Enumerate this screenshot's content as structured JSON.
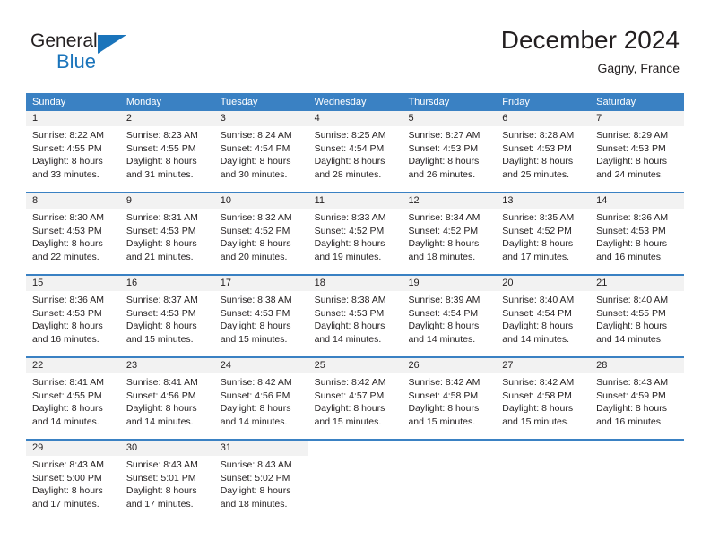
{
  "brand": {
    "name_part1": "General",
    "name_part2": "Blue",
    "accent_color": "#1a74bb",
    "triangle_icon": "triangle-icon"
  },
  "header": {
    "title": "December 2024",
    "subtitle": "Gagny, France"
  },
  "theme": {
    "header_blue": "#3a81c3",
    "daynum_gray": "#f2f2f2",
    "text": "#231f20"
  },
  "calendar": {
    "day_headers": [
      "Sunday",
      "Monday",
      "Tuesday",
      "Wednesday",
      "Thursday",
      "Friday",
      "Saturday"
    ],
    "weeks": [
      [
        {
          "day": "1",
          "sunrise": "Sunrise: 8:22 AM",
          "sunset": "Sunset: 4:55 PM",
          "daylight1": "Daylight: 8 hours",
          "daylight2": "and 33 minutes."
        },
        {
          "day": "2",
          "sunrise": "Sunrise: 8:23 AM",
          "sunset": "Sunset: 4:55 PM",
          "daylight1": "Daylight: 8 hours",
          "daylight2": "and 31 minutes."
        },
        {
          "day": "3",
          "sunrise": "Sunrise: 8:24 AM",
          "sunset": "Sunset: 4:54 PM",
          "daylight1": "Daylight: 8 hours",
          "daylight2": "and 30 minutes."
        },
        {
          "day": "4",
          "sunrise": "Sunrise: 8:25 AM",
          "sunset": "Sunset: 4:54 PM",
          "daylight1": "Daylight: 8 hours",
          "daylight2": "and 28 minutes."
        },
        {
          "day": "5",
          "sunrise": "Sunrise: 8:27 AM",
          "sunset": "Sunset: 4:53 PM",
          "daylight1": "Daylight: 8 hours",
          "daylight2": "and 26 minutes."
        },
        {
          "day": "6",
          "sunrise": "Sunrise: 8:28 AM",
          "sunset": "Sunset: 4:53 PM",
          "daylight1": "Daylight: 8 hours",
          "daylight2": "and 25 minutes."
        },
        {
          "day": "7",
          "sunrise": "Sunrise: 8:29 AM",
          "sunset": "Sunset: 4:53 PM",
          "daylight1": "Daylight: 8 hours",
          "daylight2": "and 24 minutes."
        }
      ],
      [
        {
          "day": "8",
          "sunrise": "Sunrise: 8:30 AM",
          "sunset": "Sunset: 4:53 PM",
          "daylight1": "Daylight: 8 hours",
          "daylight2": "and 22 minutes."
        },
        {
          "day": "9",
          "sunrise": "Sunrise: 8:31 AM",
          "sunset": "Sunset: 4:53 PM",
          "daylight1": "Daylight: 8 hours",
          "daylight2": "and 21 minutes."
        },
        {
          "day": "10",
          "sunrise": "Sunrise: 8:32 AM",
          "sunset": "Sunset: 4:52 PM",
          "daylight1": "Daylight: 8 hours",
          "daylight2": "and 20 minutes."
        },
        {
          "day": "11",
          "sunrise": "Sunrise: 8:33 AM",
          "sunset": "Sunset: 4:52 PM",
          "daylight1": "Daylight: 8 hours",
          "daylight2": "and 19 minutes."
        },
        {
          "day": "12",
          "sunrise": "Sunrise: 8:34 AM",
          "sunset": "Sunset: 4:52 PM",
          "daylight1": "Daylight: 8 hours",
          "daylight2": "and 18 minutes."
        },
        {
          "day": "13",
          "sunrise": "Sunrise: 8:35 AM",
          "sunset": "Sunset: 4:52 PM",
          "daylight1": "Daylight: 8 hours",
          "daylight2": "and 17 minutes."
        },
        {
          "day": "14",
          "sunrise": "Sunrise: 8:36 AM",
          "sunset": "Sunset: 4:53 PM",
          "daylight1": "Daylight: 8 hours",
          "daylight2": "and 16 minutes."
        }
      ],
      [
        {
          "day": "15",
          "sunrise": "Sunrise: 8:36 AM",
          "sunset": "Sunset: 4:53 PM",
          "daylight1": "Daylight: 8 hours",
          "daylight2": "and 16 minutes."
        },
        {
          "day": "16",
          "sunrise": "Sunrise: 8:37 AM",
          "sunset": "Sunset: 4:53 PM",
          "daylight1": "Daylight: 8 hours",
          "daylight2": "and 15 minutes."
        },
        {
          "day": "17",
          "sunrise": "Sunrise: 8:38 AM",
          "sunset": "Sunset: 4:53 PM",
          "daylight1": "Daylight: 8 hours",
          "daylight2": "and 15 minutes."
        },
        {
          "day": "18",
          "sunrise": "Sunrise: 8:38 AM",
          "sunset": "Sunset: 4:53 PM",
          "daylight1": "Daylight: 8 hours",
          "daylight2": "and 14 minutes."
        },
        {
          "day": "19",
          "sunrise": "Sunrise: 8:39 AM",
          "sunset": "Sunset: 4:54 PM",
          "daylight1": "Daylight: 8 hours",
          "daylight2": "and 14 minutes."
        },
        {
          "day": "20",
          "sunrise": "Sunrise: 8:40 AM",
          "sunset": "Sunset: 4:54 PM",
          "daylight1": "Daylight: 8 hours",
          "daylight2": "and 14 minutes."
        },
        {
          "day": "21",
          "sunrise": "Sunrise: 8:40 AM",
          "sunset": "Sunset: 4:55 PM",
          "daylight1": "Daylight: 8 hours",
          "daylight2": "and 14 minutes."
        }
      ],
      [
        {
          "day": "22",
          "sunrise": "Sunrise: 8:41 AM",
          "sunset": "Sunset: 4:55 PM",
          "daylight1": "Daylight: 8 hours",
          "daylight2": "and 14 minutes."
        },
        {
          "day": "23",
          "sunrise": "Sunrise: 8:41 AM",
          "sunset": "Sunset: 4:56 PM",
          "daylight1": "Daylight: 8 hours",
          "daylight2": "and 14 minutes."
        },
        {
          "day": "24",
          "sunrise": "Sunrise: 8:42 AM",
          "sunset": "Sunset: 4:56 PM",
          "daylight1": "Daylight: 8 hours",
          "daylight2": "and 14 minutes."
        },
        {
          "day": "25",
          "sunrise": "Sunrise: 8:42 AM",
          "sunset": "Sunset: 4:57 PM",
          "daylight1": "Daylight: 8 hours",
          "daylight2": "and 15 minutes."
        },
        {
          "day": "26",
          "sunrise": "Sunrise: 8:42 AM",
          "sunset": "Sunset: 4:58 PM",
          "daylight1": "Daylight: 8 hours",
          "daylight2": "and 15 minutes."
        },
        {
          "day": "27",
          "sunrise": "Sunrise: 8:42 AM",
          "sunset": "Sunset: 4:58 PM",
          "daylight1": "Daylight: 8 hours",
          "daylight2": "and 15 minutes."
        },
        {
          "day": "28",
          "sunrise": "Sunrise: 8:43 AM",
          "sunset": "Sunset: 4:59 PM",
          "daylight1": "Daylight: 8 hours",
          "daylight2": "and 16 minutes."
        }
      ],
      [
        {
          "day": "29",
          "sunrise": "Sunrise: 8:43 AM",
          "sunset": "Sunset: 5:00 PM",
          "daylight1": "Daylight: 8 hours",
          "daylight2": "and 17 minutes."
        },
        {
          "day": "30",
          "sunrise": "Sunrise: 8:43 AM",
          "sunset": "Sunset: 5:01 PM",
          "daylight1": "Daylight: 8 hours",
          "daylight2": "and 17 minutes."
        },
        {
          "day": "31",
          "sunrise": "Sunrise: 8:43 AM",
          "sunset": "Sunset: 5:02 PM",
          "daylight1": "Daylight: 8 hours",
          "daylight2": "and 18 minutes."
        },
        {
          "day": "",
          "sunrise": "",
          "sunset": "",
          "daylight1": "",
          "daylight2": ""
        },
        {
          "day": "",
          "sunrise": "",
          "sunset": "",
          "daylight1": "",
          "daylight2": ""
        },
        {
          "day": "",
          "sunrise": "",
          "sunset": "",
          "daylight1": "",
          "daylight2": ""
        },
        {
          "day": "",
          "sunrise": "",
          "sunset": "",
          "daylight1": "",
          "daylight2": ""
        }
      ]
    ]
  }
}
